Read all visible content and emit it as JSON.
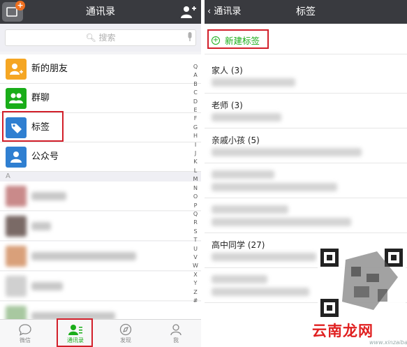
{
  "left": {
    "title": "通讯录",
    "search_placeholder": "搜索",
    "menu_items": [
      {
        "label": "新的朋友",
        "icon": "new-friend-icon",
        "color": "#f5a623"
      },
      {
        "label": "群聊",
        "icon": "group-chat-icon",
        "color": "#1aad19"
      },
      {
        "label": "标签",
        "icon": "tag-icon",
        "color": "#2f7fd1"
      },
      {
        "label": "公众号",
        "icon": "official-account-icon",
        "color": "#2f7fd1"
      }
    ],
    "section_letter": "A",
    "index_letters": [
      "Q",
      "A",
      "B",
      "C",
      "D",
      "E",
      "F",
      "G",
      "H",
      "I",
      "J",
      "K",
      "L",
      "M",
      "N",
      "O",
      "P",
      "Q",
      "R",
      "S",
      "T",
      "U",
      "V",
      "W",
      "X",
      "Y",
      "Z",
      "#"
    ],
    "tabs": [
      {
        "label": "微信",
        "icon": "chat-bubble-icon"
      },
      {
        "label": "通讯录",
        "icon": "contacts-icon"
      },
      {
        "label": "发现",
        "icon": "compass-icon"
      },
      {
        "label": "我",
        "icon": "person-icon"
      }
    ],
    "active_tab": 1,
    "accent_color": "#1aad19"
  },
  "right": {
    "back_label": "通讯录",
    "title": "标签",
    "new_tag_label": "新建标签",
    "tags": [
      {
        "label": "家人 (3)"
      },
      {
        "label": "老师 (3)"
      },
      {
        "label": "亲戚小孩 (5)"
      },
      {
        "label": ""
      },
      {
        "label": ""
      },
      {
        "label": "高中同学 (27)"
      },
      {
        "label": ""
      }
    ]
  },
  "watermark": {
    "text": "云南龙网",
    "url": "www.xinzaiba.com"
  }
}
